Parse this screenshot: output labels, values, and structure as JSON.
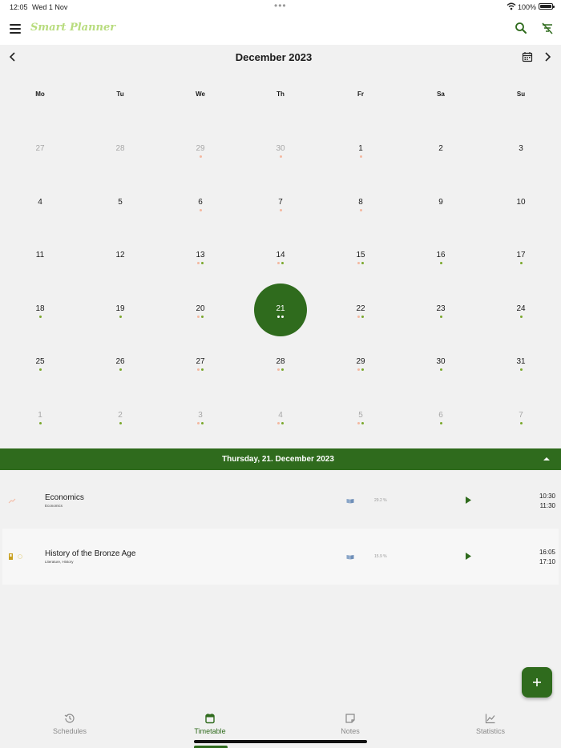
{
  "status": {
    "time": "12:05",
    "date": "Wed 1 Nov",
    "battery": "100%"
  },
  "app": {
    "title": "Smart Planner"
  },
  "calendar": {
    "month_title": "December 2023",
    "weekdays": [
      "Mo",
      "Tu",
      "We",
      "Th",
      "Fr",
      "Sa",
      "Su"
    ],
    "weeks": [
      [
        {
          "d": "27",
          "m": true,
          "dots": []
        },
        {
          "d": "28",
          "m": true,
          "dots": []
        },
        {
          "d": "29",
          "m": true,
          "dots": [
            "s"
          ]
        },
        {
          "d": "30",
          "m": true,
          "dots": [
            "s"
          ]
        },
        {
          "d": "1",
          "dots": [
            "s"
          ]
        },
        {
          "d": "2",
          "dots": []
        },
        {
          "d": "3",
          "dots": []
        }
      ],
      [
        {
          "d": "4",
          "dots": []
        },
        {
          "d": "5",
          "dots": []
        },
        {
          "d": "6",
          "dots": [
            "s"
          ]
        },
        {
          "d": "7",
          "dots": [
            "s"
          ]
        },
        {
          "d": "8",
          "dots": [
            "s"
          ]
        },
        {
          "d": "9",
          "dots": []
        },
        {
          "d": "10",
          "dots": []
        }
      ],
      [
        {
          "d": "11",
          "dots": []
        },
        {
          "d": "12",
          "dots": []
        },
        {
          "d": "13",
          "dots": [
            "s",
            "g"
          ]
        },
        {
          "d": "14",
          "dots": [
            "s",
            "g"
          ]
        },
        {
          "d": "15",
          "dots": [
            "s",
            "g"
          ]
        },
        {
          "d": "16",
          "dots": [
            "g"
          ]
        },
        {
          "d": "17",
          "dots": [
            "g"
          ]
        }
      ],
      [
        {
          "d": "18",
          "dots": [
            "g"
          ]
        },
        {
          "d": "19",
          "dots": [
            "g"
          ]
        },
        {
          "d": "20",
          "dots": [
            "s",
            "g"
          ]
        },
        {
          "d": "21",
          "sel": true,
          "dots": [
            "w",
            "w"
          ]
        },
        {
          "d": "22",
          "dots": [
            "s",
            "g"
          ]
        },
        {
          "d": "23",
          "dots": [
            "g"
          ]
        },
        {
          "d": "24",
          "dots": [
            "g"
          ]
        }
      ],
      [
        {
          "d": "25",
          "dots": [
            "g"
          ]
        },
        {
          "d": "26",
          "dots": [
            "g"
          ]
        },
        {
          "d": "27",
          "dots": [
            "s",
            "g"
          ]
        },
        {
          "d": "28",
          "dots": [
            "s",
            "g"
          ]
        },
        {
          "d": "29",
          "dots": [
            "s",
            "g"
          ]
        },
        {
          "d": "30",
          "dots": [
            "g"
          ]
        },
        {
          "d": "31",
          "dots": [
            "g"
          ]
        }
      ],
      [
        {
          "d": "1",
          "m": true,
          "dots": [
            "g"
          ]
        },
        {
          "d": "2",
          "m": true,
          "dots": [
            "g"
          ]
        },
        {
          "d": "3",
          "m": true,
          "dots": [
            "s",
            "g"
          ]
        },
        {
          "d": "4",
          "m": true,
          "dots": [
            "s",
            "g"
          ]
        },
        {
          "d": "5",
          "m": true,
          "dots": [
            "s",
            "g"
          ]
        },
        {
          "d": "6",
          "m": true,
          "dots": [
            "g"
          ]
        },
        {
          "d": "7",
          "m": true,
          "dots": [
            "g"
          ]
        }
      ]
    ]
  },
  "dot_colors": {
    "s": "#f4b8a0",
    "g": "#7aa82c",
    "w": "#ffffff"
  },
  "colors": {
    "accent": "#2f6b1d",
    "title_green": "#b8dc7e"
  },
  "selected_day": {
    "label": "Thursday, 21. December 2023"
  },
  "events": [
    {
      "title": "Economics",
      "subtitle": "Economics",
      "percent": "29.2 %",
      "start": "10:30",
      "end": "11:30",
      "icon": "trend-icon"
    },
    {
      "title": "History of the Bronze Age",
      "subtitle": "Literature, History",
      "percent": "15.9 %",
      "start": "16:05",
      "end": "17:10",
      "icon": "book-bookmark-icon"
    }
  ],
  "nav": [
    {
      "label": "Schedules",
      "icon": "history-icon",
      "active": false
    },
    {
      "label": "Timetable",
      "icon": "calendar-icon",
      "active": true
    },
    {
      "label": "Notes",
      "icon": "note-icon",
      "active": false
    },
    {
      "label": "Statistics",
      "icon": "chart-icon",
      "active": false
    }
  ]
}
